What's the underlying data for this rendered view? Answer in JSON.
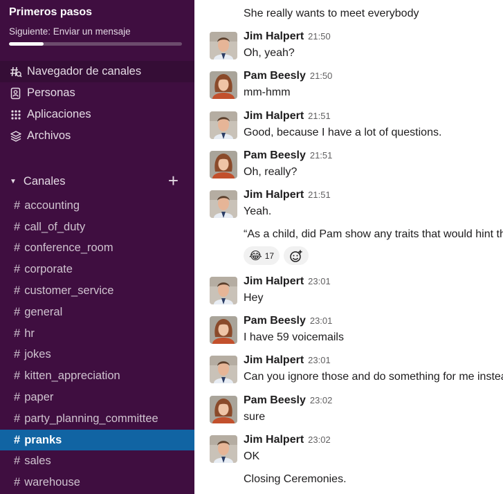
{
  "onboarding": {
    "title": "Primeros pasos",
    "next": "Siguiente: Enviar un mensaje",
    "progress": 0.2
  },
  "nav": {
    "items": [
      {
        "label": "Navegador de canales",
        "icon": "channel-browser-icon"
      },
      {
        "label": "Personas",
        "icon": "people-icon"
      },
      {
        "label": "Aplicaciones",
        "icon": "apps-icon"
      },
      {
        "label": "Archivos",
        "icon": "files-icon"
      }
    ]
  },
  "channels": {
    "header": "Canales",
    "hash": "#",
    "add": "+",
    "items": [
      "accounting",
      "call_of_duty",
      "conference_room",
      "corporate",
      "customer_service",
      "general",
      "hr",
      "jokes",
      "kitten_appreciation",
      "paper",
      "party_planning_committee",
      "pranks",
      "sales",
      "warehouse"
    ],
    "active": "pranks"
  },
  "messages": {
    "top_continuation": "She really wants to meet everybody",
    "list": [
      {
        "author": "Jim Halpert",
        "time": "21:50",
        "text": "Oh, yeah?"
      },
      {
        "author": "Pam Beesly",
        "time": "21:50",
        "text": "mm-hmm"
      },
      {
        "author": "Jim Halpert",
        "time": "21:51",
        "text": "Good, because I have a lot of questions."
      },
      {
        "author": "Pam Beesly",
        "time": "21:51",
        "text": "Oh, really?"
      },
      {
        "author": "Jim Halpert",
        "time": "21:51",
        "text": "Yeah."
      },
      {
        "author": "Jim Halpert",
        "time": "23:01",
        "text": "Hey"
      },
      {
        "author": "Pam Beesly",
        "time": "23:01",
        "text": "I have 59 voicemails"
      },
      {
        "author": "Jim Halpert",
        "time": "23:01",
        "text": "Can you ignore those and do something for me instead?"
      },
      {
        "author": "Pam Beesly",
        "time": "23:02",
        "text": "sure"
      },
      {
        "author": "Jim Halpert",
        "time": "23:02",
        "text": "OK"
      }
    ],
    "followup": "“As a child, did Pam show any traits that would hint that she would grow up to be",
    "reaction": {
      "emoji": "😂",
      "count": "17"
    },
    "closing": "Closing Ceremonies."
  },
  "colors": {
    "sidebar": "#3f0e40",
    "active_channel": "#1164a3"
  }
}
